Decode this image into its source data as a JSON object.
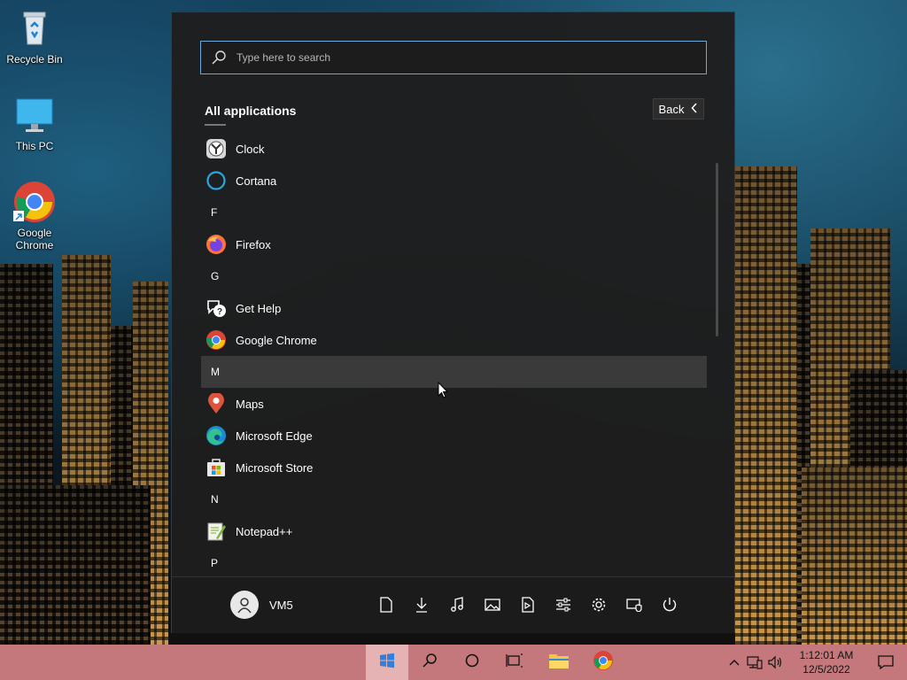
{
  "desktop": {
    "icons": [
      {
        "label": "Recycle Bin"
      },
      {
        "label": "This PC"
      },
      {
        "label": "Google Chrome"
      }
    ]
  },
  "start_menu": {
    "search": {
      "placeholder": "Type here to search"
    },
    "apps_title": "All applications",
    "back_label": "Back",
    "list": [
      {
        "type": "app",
        "label": "Clock",
        "icon": "clock-icon"
      },
      {
        "type": "app",
        "label": "Cortana",
        "icon": "cortana-icon"
      },
      {
        "type": "letter",
        "label": "F"
      },
      {
        "type": "app",
        "label": "Firefox",
        "icon": "firefox-icon"
      },
      {
        "type": "letter",
        "label": "G"
      },
      {
        "type": "app",
        "label": "Get Help",
        "icon": "get-help-icon"
      },
      {
        "type": "app",
        "label": "Google Chrome",
        "icon": "chrome-icon"
      },
      {
        "type": "letter",
        "label": "M"
      },
      {
        "type": "app",
        "label": "Maps",
        "icon": "maps-icon"
      },
      {
        "type": "app",
        "label": "Microsoft Edge",
        "icon": "edge-icon"
      },
      {
        "type": "app",
        "label": "Microsoft Store",
        "icon": "store-icon"
      },
      {
        "type": "letter",
        "label": "N"
      },
      {
        "type": "app",
        "label": "Notepad++",
        "icon": "notepadpp-icon"
      },
      {
        "type": "letter",
        "label": "P"
      }
    ],
    "user": {
      "name": "VM5"
    },
    "quick_icons": [
      "documents-icon",
      "downloads-icon",
      "music-icon",
      "pictures-icon",
      "videos-icon",
      "settings-sliders-icon",
      "gear-icon",
      "security-icon",
      "power-icon"
    ]
  },
  "taskbar": {
    "items": [
      "start-icon",
      "search-icon",
      "cortana-circle-icon",
      "task-view-icon",
      "file-explorer-icon",
      "chrome-icon"
    ],
    "time": "1:12:01 AM",
    "date": "12/5/2022",
    "tray_icons": [
      "chevron-up-icon",
      "network-icon",
      "volume-icon",
      "notification-icon"
    ],
    "colors": {
      "taskbar": "#c5787c",
      "active": "#e6b3b5"
    }
  }
}
